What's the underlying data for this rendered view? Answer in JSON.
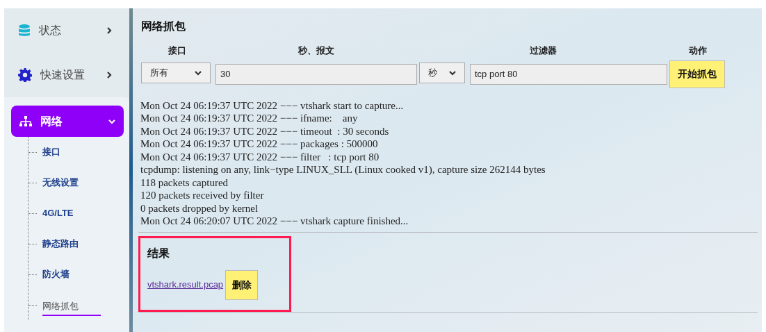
{
  "sidebar": {
    "items": [
      {
        "label": "状态",
        "expanded": false
      },
      {
        "label": "快速设置",
        "expanded": false
      },
      {
        "label": "网络",
        "expanded": true,
        "children": [
          {
            "label": "接口",
            "selected": false
          },
          {
            "label": "无线设置",
            "selected": false
          },
          {
            "label": "4G/LTE",
            "selected": false
          },
          {
            "label": "静态路由",
            "selected": false
          },
          {
            "label": "防火墙",
            "selected": false
          },
          {
            "label": "网络抓包",
            "selected": true
          }
        ]
      }
    ]
  },
  "capture": {
    "title": "网络抓包",
    "columns": [
      "接口",
      "秒、报文",
      "过滤器",
      "动作"
    ],
    "interface": {
      "value": "所有"
    },
    "duration": {
      "value": "30"
    },
    "unit": {
      "value": "秒"
    },
    "filter": {
      "value": "tcp port 80"
    },
    "start_button": "开始抓包",
    "log": [
      "Mon Oct 24 06:19:37 UTC 2022 −−− vtshark start to capture...",
      "Mon Oct 24 06:19:37 UTC 2022 −−− ifname:    any",
      "Mon Oct 24 06:19:37 UTC 2022 −−− timeout  : 30 seconds",
      "Mon Oct 24 06:19:37 UTC 2022 −−− packages : 500000",
      "Mon Oct 24 06:19:37 UTC 2022 −−− filter   : tcp port 80",
      "tcpdump: listening on any, link−type LINUX_SLL (Linux cooked v1), capture size 262144 bytes",
      "118 packets captured",
      "120 packets received by filter",
      "0 packets dropped by kernel",
      "Mon Oct 24 06:20:07 UTC 2022 −−− vtshark capture finished..."
    ]
  },
  "result": {
    "title": "结果",
    "file_link": "vtshark.result.pcap",
    "delete_button": "删除"
  }
}
